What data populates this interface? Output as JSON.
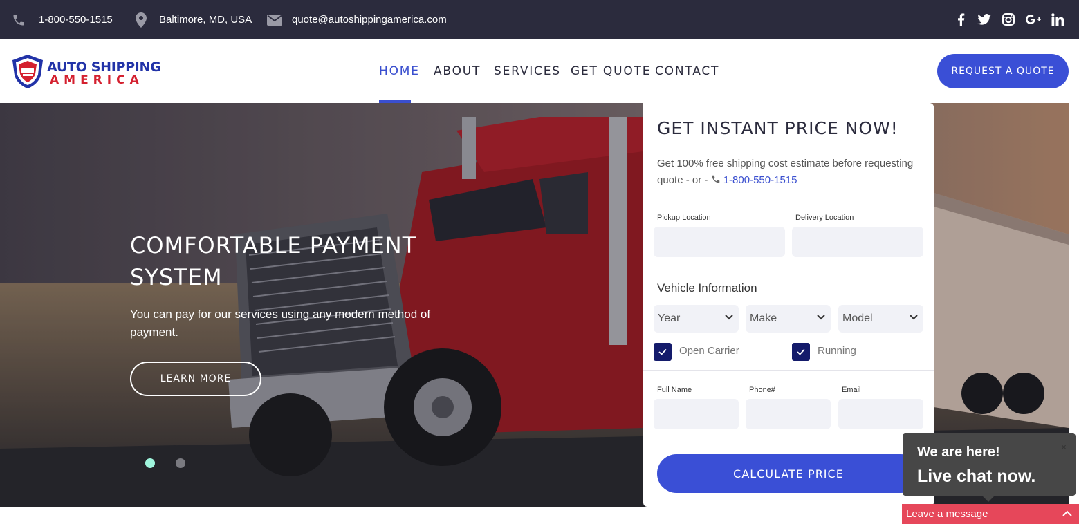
{
  "topbar": {
    "phone": "1-800-550-1515",
    "location": "Baltimore, MD, USA",
    "email": "quote@autoshippingamerica.com",
    "icons": [
      "phone-icon",
      "map-pin-icon",
      "mail-icon"
    ],
    "social": [
      "facebook-icon",
      "twitter-icon",
      "instagram-icon",
      "google-plus-icon",
      "linkedin-icon"
    ]
  },
  "header": {
    "logo_line1": "AUTO SHIPPING",
    "logo_line2": "AMERICA",
    "nav": {
      "home": "HOME",
      "about": "ABOUT",
      "services": "SERVICES",
      "get_quote": "GET QUOTE",
      "contact": "CONTACT"
    },
    "active": "HOME",
    "cta": "REQUEST A QUOTE"
  },
  "hero": {
    "title": "COMFORTABLE PAYMENT SYSTEM",
    "text": "You can pay for our services using any modern method of payment.",
    "button": "LEARN MORE",
    "slides": 2,
    "active_slide": 1
  },
  "form": {
    "title": "GET INSTANT PRICE NOW!",
    "subtitle": "Get 100% free shipping cost estimate before requesting quote - or -",
    "phone": "1-800-550-1515",
    "pickup_label": "Pickup Location",
    "delivery_label": "Delivery Location",
    "pickup_value": "",
    "delivery_value": "",
    "vehicle_title": "Vehicle Information",
    "year": "Year",
    "make": "Make",
    "model": "Model",
    "open_carrier": "Open Carrier",
    "running": "Running",
    "open_carrier_checked": true,
    "running_checked": true,
    "full_name_label": "Full Name",
    "phone_label": "Phone#",
    "email_label": "Email",
    "full_name_value": "",
    "phone_value": "",
    "email_value": "",
    "submit": "CALCULATE PRICE"
  },
  "chat": {
    "line1": "We are here!",
    "line2": "Live chat now.",
    "close": "×",
    "leave_message": "Leave a message"
  },
  "colors": {
    "accent": "#3a4fd6",
    "topbar": "#2b2b3d",
    "logo_blue": "#2233a8",
    "logo_red": "#d4202f",
    "checkbox": "#141b6b",
    "chat": "#474747",
    "leave": "#e6475a",
    "dot_active": "#9ff5dc"
  }
}
